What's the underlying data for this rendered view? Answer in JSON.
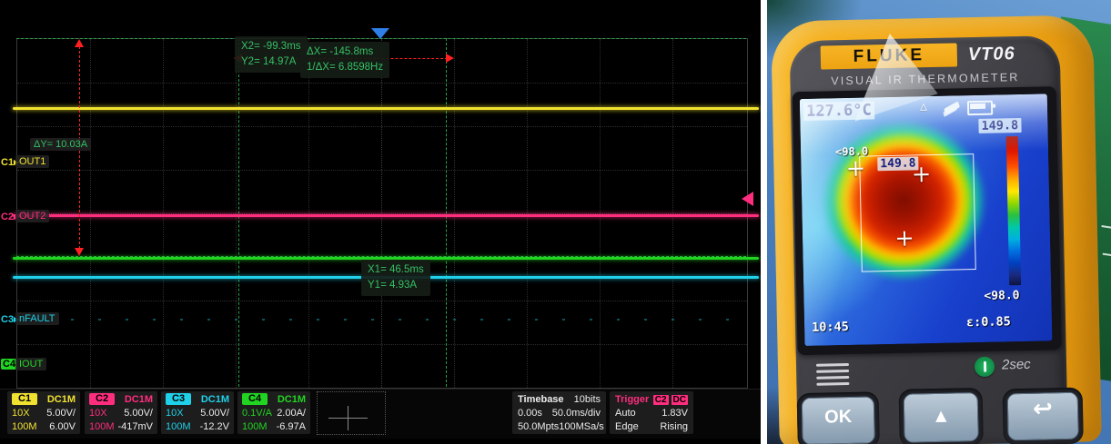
{
  "scope": {
    "cursor_readouts": {
      "x2": "X2= -99.3ms",
      "y2": "Y2= 14.97A",
      "dx": "ΔX= -145.8ms",
      "inv_dx": "1/ΔX= 6.8598Hz",
      "x1": "X1= 46.5ms",
      "y1": "Y1= 4.93A",
      "dy": "ΔY= 10.03A"
    },
    "channels": [
      {
        "id": "C1",
        "color": "#f0e130",
        "coupling": "DC1M",
        "probe": "10X",
        "scale": "5.00V/",
        "bandwidth": "100M",
        "offset": "6.00V",
        "label": "OUT1"
      },
      {
        "id": "C2",
        "color": "#ff2d7e",
        "coupling": "DC1M",
        "probe": "10X",
        "scale": "5.00V/",
        "bandwidth": "100M",
        "offset": "-417mV",
        "label": "OUT2"
      },
      {
        "id": "C3",
        "color": "#1fd0e8",
        "coupling": "DC1M",
        "probe": "10X",
        "scale": "5.00V/",
        "bandwidth": "100M",
        "offset": "-12.2V",
        "label": "nFAULT"
      },
      {
        "id": "C4",
        "color": "#21d421",
        "coupling": "DC1M",
        "probe": "0.1V/A",
        "scale": "2.00A/",
        "bandwidth": "100M",
        "offset": "-6.97A",
        "label": "IOUT"
      }
    ],
    "timebase": {
      "title": "Timebase",
      "resolution": "10bits",
      "delay": "0.00s",
      "scale": "50.0ms/div",
      "memory": "50.0Mpts",
      "sample_rate": "100MSa/s"
    },
    "trigger": {
      "title": "Trigger",
      "source": "C2",
      "coupling": "DC",
      "mode": "Auto",
      "level": "1.83V",
      "type": "Edge",
      "slope": "Rising"
    }
  },
  "thermometer": {
    "brand": "FLUKE",
    "model": "VT06",
    "subtitle": "VISUAL IR THERMOMETER",
    "display": {
      "center_temp": "127.6°C",
      "scale_max": "149.8",
      "scale_min": "<98.0",
      "spot_min": "<98.0",
      "spot_max": "149.8",
      "time": "10:45",
      "emissivity": "ε:0.85"
    },
    "controls": {
      "ok": "OK",
      "power_hold": "2sec"
    }
  },
  "icons": {
    "marker_arrow": "▸",
    "up_arrow": "▲",
    "back_arrow": "↩",
    "warning_triangle": "△"
  },
  "colors": {
    "cursor_green": "#35c065",
    "cursor_red": "#ff2020",
    "trigger_blue": "#2f7fe8",
    "trigger_level_pink": "#ff2d7e",
    "device_yellow": "#f2a512",
    "thermal_hot": "#d42400",
    "thermal_cold": "#1438c8"
  }
}
